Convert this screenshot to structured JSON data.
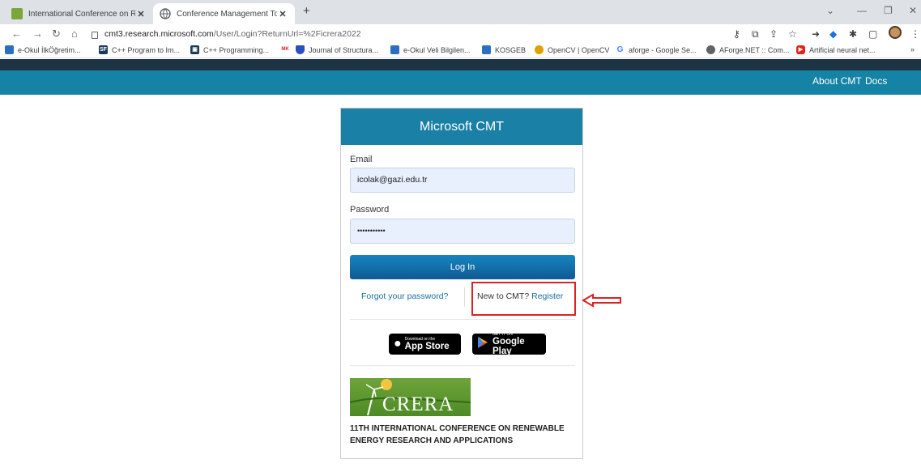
{
  "browser": {
    "tabs": [
      {
        "title": "International Conference on Rene",
        "active": false
      },
      {
        "title": "Conference Management Toolkit",
        "active": true
      }
    ],
    "new_tab": "+",
    "url": {
      "host": "cmt3.research.microsoft.com",
      "path": "/User/Login?ReturnUrl=%2Ficrera2022"
    },
    "bookmarks": [
      {
        "label": "e-Okul İlkÖğretim...",
        "icon": "bird-icon",
        "color": "#2b6fc2"
      },
      {
        "label": "C++ Program to Im...",
        "icon": "sf-icon",
        "color": "#1a3a5a"
      },
      {
        "label": "C++ Programming...",
        "icon": "code-icon",
        "color": "#1a3a5a"
      },
      {
        "label": "Journal of Structura...",
        "icon": "shield-icon",
        "color": "#2b4fc2"
      },
      {
        "label": "e-Okul Veli Bilgilen...",
        "icon": "bird-icon",
        "color": "#2b6fc2"
      },
      {
        "label": "KOSGEB",
        "icon": "kosgeb-icon",
        "color": "#2b6fc2"
      },
      {
        "label": "OpenCV | OpenCV",
        "icon": "opencv-icon",
        "color": "#e0a000"
      },
      {
        "label": "aforge - Google Se...",
        "icon": "google-icon",
        "color": "#4285f4"
      },
      {
        "label": "AForge.NET :: Com...",
        "icon": "globe-icon",
        "color": "#5f6368"
      },
      {
        "label": "Artificial neural net...",
        "icon": "youtube-icon",
        "color": "#e62117"
      }
    ],
    "bookmarks_more": "»"
  },
  "site": {
    "nav": [
      "About CMT",
      "Docs"
    ]
  },
  "login": {
    "header": "Microsoft CMT",
    "email_label": "Email",
    "email_value": "icolak@gazi.edu.tr",
    "password_label": "Password",
    "password_value": "•••••••••••",
    "login_button": "Log In",
    "forgot_link": "Forgot your password?",
    "new_prompt": "New to CMT?",
    "register_link": "Register",
    "app_store": {
      "small": "Download on the",
      "big": "App Store"
    },
    "google_play": {
      "small": "GET IT ON",
      "big": "Google Play"
    },
    "conference_logo_text": "CRERA",
    "conference_name": "11TH INTERNATIONAL CONFERENCE ON RENEWABLE ENERGY RESEARCH AND APPLICATIONS"
  },
  "annotation": {
    "color": "#dd2222"
  }
}
